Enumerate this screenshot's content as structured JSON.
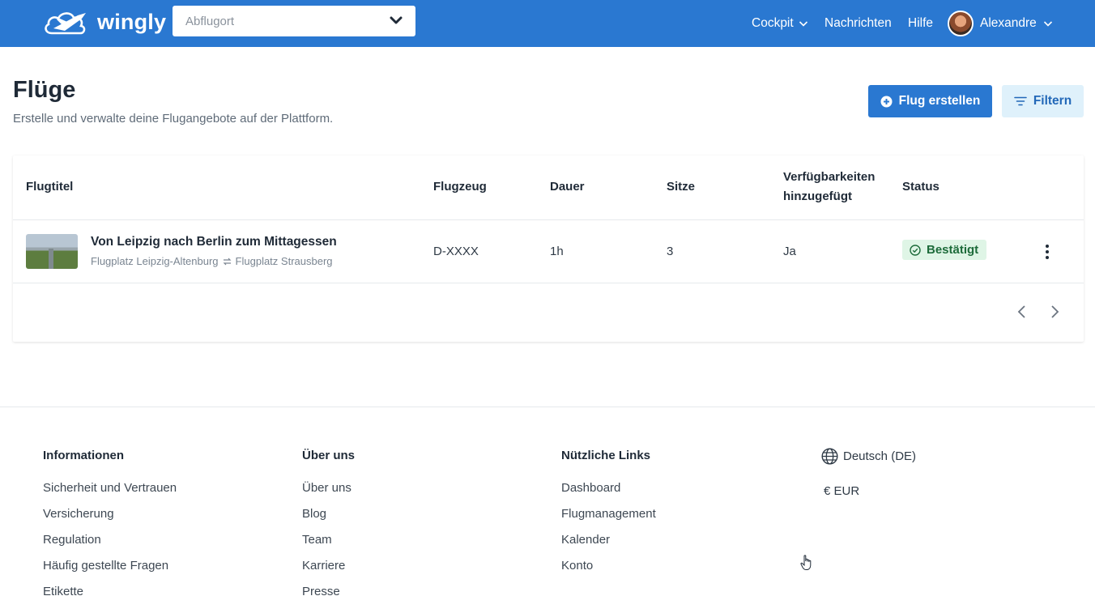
{
  "header": {
    "brand": "wingly",
    "departure_placeholder": "Abflugort",
    "nav": {
      "cockpit": "Cockpit",
      "messages": "Nachrichten",
      "help": "Hilfe",
      "user": "Alexandre"
    }
  },
  "page": {
    "title": "Flüge",
    "subtitle": "Erstelle und verwalte deine Flugangebote auf der Plattform.",
    "create_button": "Flug erstellen",
    "filter_button": "Filtern"
  },
  "table": {
    "columns": {
      "title": "Flugtitel",
      "aircraft": "Flugzeug",
      "duration": "Dauer",
      "seats": "Sitze",
      "availability_line1": "Verfügbarkeiten",
      "availability_line2": "hinzugefügt",
      "status": "Status"
    },
    "rows": [
      {
        "title": "Von Leipzig nach Berlin zum Mittagessen",
        "from": "Flugplatz Leipzig-Altenburg",
        "to": "Flugplatz Strausberg",
        "aircraft": "D-XXXX",
        "duration": "1h",
        "seats": "3",
        "availability": "Ja",
        "status": "Bestätigt"
      }
    ]
  },
  "footer": {
    "informationen": {
      "heading": "Informationen",
      "links": [
        "Sicherheit und Vertrauen",
        "Versicherung",
        "Regulation",
        "Häufig gestellte Fragen",
        "Etikette"
      ]
    },
    "ueber_uns": {
      "heading": "Über uns",
      "links": [
        "Über uns",
        "Blog",
        "Team",
        "Karriere",
        "Presse"
      ]
    },
    "nuetzliche_links": {
      "heading": "Nützliche Links",
      "links": [
        "Dashboard",
        "Flugmanagement",
        "Kalender",
        "Konto"
      ]
    },
    "language": "Deutsch (DE)",
    "currency": "€ EUR"
  },
  "colors": {
    "brand_blue": "#2a78d1",
    "filter_bg": "#dff1fb",
    "status_bg": "#dff5e6",
    "status_text": "#1d6b3a"
  }
}
